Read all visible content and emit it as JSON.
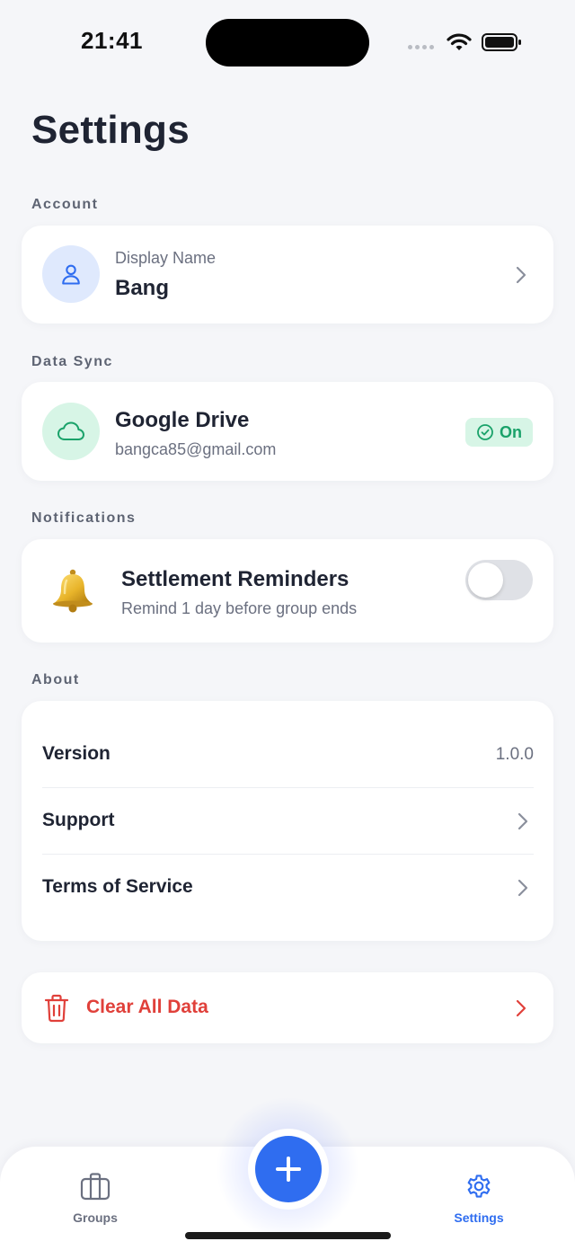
{
  "status_bar": {
    "time": "21:41"
  },
  "page": {
    "title": "Settings"
  },
  "account": {
    "section_label": "Account",
    "display_name_label": "Display Name",
    "display_name_value": "Bang"
  },
  "data_sync": {
    "section_label": "Data Sync",
    "provider": "Google Drive",
    "email": "bangca85@gmail.com",
    "status": "On"
  },
  "notifications": {
    "section_label": "Notifications",
    "title": "Settlement Reminders",
    "subtitle": "Remind 1 day before group ends",
    "toggle_on": false
  },
  "about": {
    "section_label": "About",
    "rows": [
      {
        "label": "Version",
        "value": "1.0.0"
      },
      {
        "label": "Support"
      },
      {
        "label": "Terms of Service"
      }
    ]
  },
  "danger": {
    "clear_label": "Clear All Data"
  },
  "bottom_nav": {
    "groups_label": "Groups",
    "settings_label": "Settings",
    "active": "settings"
  },
  "colors": {
    "accent": "#2f6df0",
    "danger": "#e0403a",
    "success": "#1aa26a",
    "inactive": "#6b7080"
  }
}
